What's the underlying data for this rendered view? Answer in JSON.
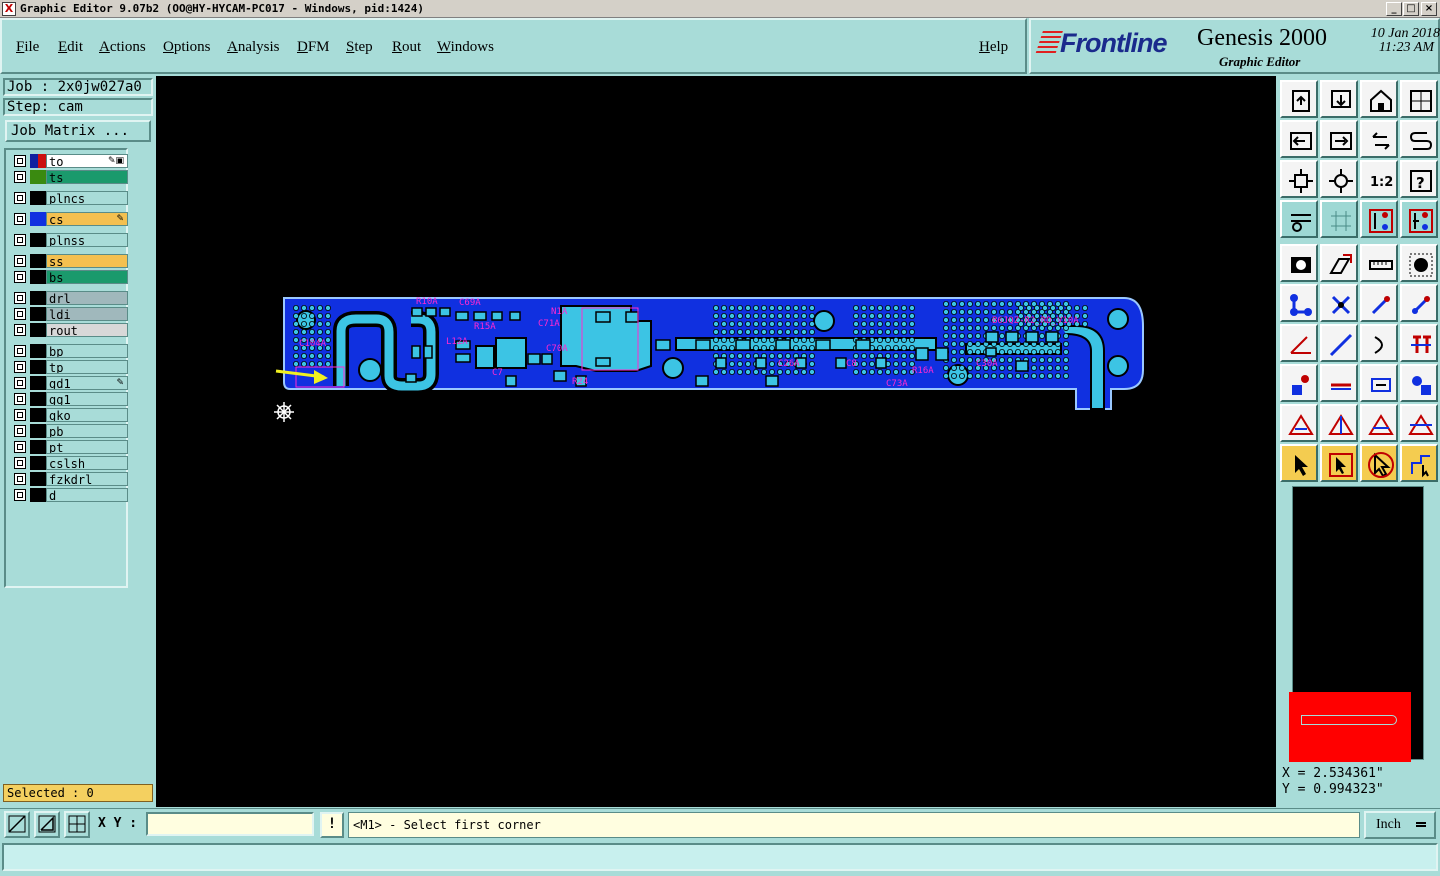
{
  "window": {
    "title": "Graphic Editor 9.07b2 (OO@HY-HYCAM-PC017 - Windows, pid:1424)",
    "min": "_",
    "max": "□",
    "close": "×"
  },
  "menu": [
    "File",
    "Edit",
    "Actions",
    "Options",
    "Analysis",
    "DFM",
    "Step",
    "Rout",
    "Windows"
  ],
  "help": "Help",
  "brand": {
    "logo": "Frontline",
    "product": "Genesis 2000",
    "subtitle": "Graphic Editor",
    "date": "10 Jan 2018",
    "time": "11:23 AM"
  },
  "job": {
    "job_label": "Job : 2x0jw027a0",
    "step_label": "Step: cam",
    "matrix_button": "Job Matrix ..."
  },
  "layers": [
    {
      "name": "to",
      "bg": "#ffffff",
      "swatch": "#cc1010",
      "sw2": "#1020a0",
      "mark": "✎▣"
    },
    {
      "name": "ts",
      "bg": "#1a9a6c",
      "swatch": "#3a8a10",
      "mark": ""
    },
    {
      "name": "plncs",
      "bg": "#a8dcd8",
      "swatch": "#000000",
      "mark": ""
    },
    {
      "name": "cs",
      "bg": "#f4c050",
      "swatch": "#1030e0",
      "mark": "✎"
    },
    {
      "name": "plnss",
      "bg": "#a8dcd8",
      "swatch": "#000000",
      "mark": ""
    },
    {
      "name": "ss",
      "bg": "#f4c050",
      "swatch": "#000000",
      "mark": ""
    },
    {
      "name": "bs",
      "bg": "#1a9a6c",
      "swatch": "#000000",
      "mark": ""
    },
    {
      "name": "drl",
      "bg": "#a0b8bc",
      "swatch": "#000000",
      "mark": ""
    },
    {
      "name": "ldi",
      "bg": "#a0b8bc",
      "swatch": "#000000",
      "mark": ""
    },
    {
      "name": "rout",
      "bg": "#d8d8d8",
      "swatch": "#000000",
      "mark": ""
    },
    {
      "name": "bp",
      "bg": "#a8dcd8",
      "swatch": "#000000",
      "mark": ""
    },
    {
      "name": "tp",
      "bg": "#a8dcd8",
      "swatch": "#000000",
      "mark": ""
    },
    {
      "name": "gd1",
      "bg": "#a8dcd8",
      "swatch": "#000000",
      "mark": "✎"
    },
    {
      "name": "gg1",
      "bg": "#a8dcd8",
      "swatch": "#000000",
      "mark": ""
    },
    {
      "name": "gko",
      "bg": "#a8dcd8",
      "swatch": "#000000",
      "mark": ""
    },
    {
      "name": "pb",
      "bg": "#a8dcd8",
      "swatch": "#000000",
      "mark": ""
    },
    {
      "name": "pt",
      "bg": "#a8dcd8",
      "swatch": "#000000",
      "mark": ""
    },
    {
      "name": "cslsh",
      "bg": "#a8dcd8",
      "swatch": "#000000",
      "mark": ""
    },
    {
      "name": "fzkdrl",
      "bg": "#a8dcd8",
      "swatch": "#000000",
      "mark": ""
    },
    {
      "name": "d",
      "bg": "#a8dcd8",
      "swatch": "#000000",
      "mark": ""
    }
  ],
  "selected": "Selected : 0",
  "board_labels": [
    "R10A",
    "C69A",
    "N1A",
    "C71A",
    "R15A",
    "L12A",
    "C70A",
    "C7",
    "R24",
    "B6JQZ-R2_RD_V10A",
    "R16A",
    "C73A",
    "C26A",
    "C8",
    "C104A",
    "C30A"
  ],
  "toolbar_icons": [
    "open-job-icon",
    "save-icon",
    "home-icon",
    "window-split-icon",
    "move-left-icon",
    "move-right-icon",
    "swap-icon",
    "redraw-icon",
    "zoom-fit-icon",
    "zoom-center-icon",
    "scale-1-2-icon",
    "query-icon",
    "snap-settings-icon",
    "grid-icon",
    "display-layers-icon",
    "display-layers-alt-icon",
    "camera-icon",
    "measure-icon",
    "ruler-icon",
    "circle-pad-icon",
    "connect-icon",
    "cross-icon",
    "line-add-icon",
    "line-add-alt-icon",
    "angle-icon",
    "slash-line-icon",
    "arc-icon",
    "text-icon",
    "dot-icon",
    "horizontal-line-icon",
    "resize-icon",
    "group-icon",
    "triangle-icon",
    "triangle-alt-icon",
    "triangle-arrow-icon",
    "triangle-cross-icon",
    "pointer-icon",
    "pointer-box-icon",
    "pointer-outline-icon",
    "route-icon"
  ],
  "coords": {
    "x": "X = 2.534361\"",
    "y": "Y = 0.994323\""
  },
  "xy_label": "X Y :",
  "xy_value": "",
  "msg_button": "!",
  "prompt": "<M1> - Select first corner",
  "unit": "Inch"
}
